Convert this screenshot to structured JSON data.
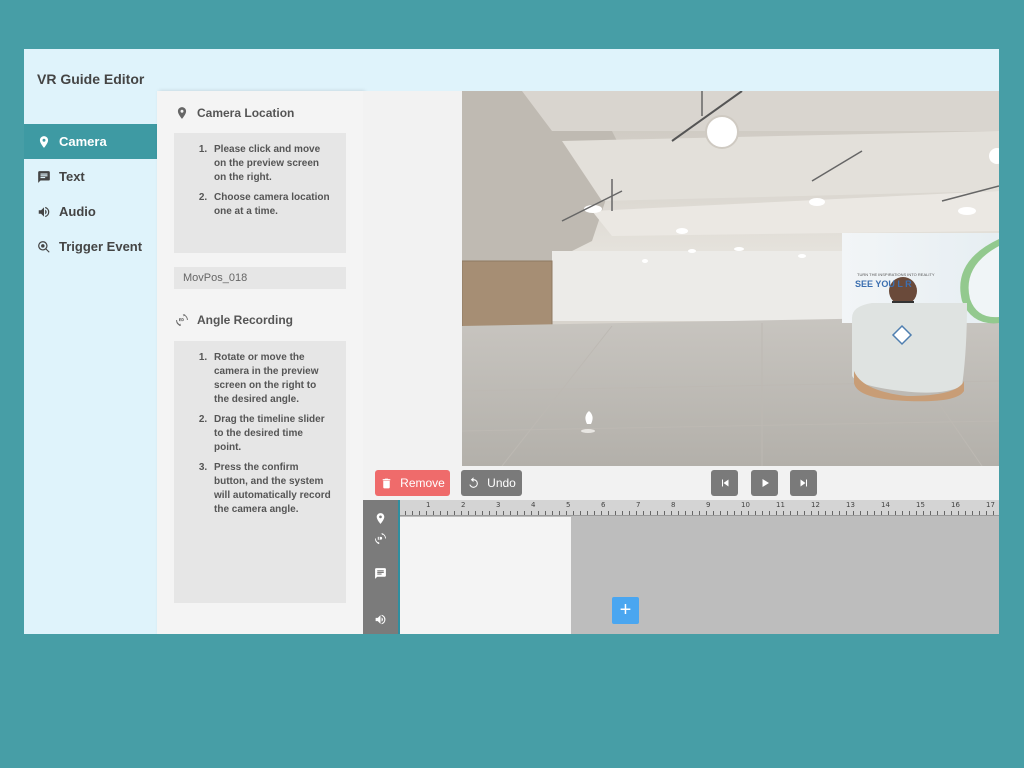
{
  "app": {
    "title": "VR Guide Editor"
  },
  "nav": {
    "items": [
      {
        "label": "Camera",
        "icon": "location-pin-icon",
        "active": true
      },
      {
        "label": "Text",
        "icon": "comment-icon",
        "active": false
      },
      {
        "label": "Audio",
        "icon": "volume-icon",
        "active": false
      },
      {
        "label": "Trigger Event",
        "icon": "search-gear-icon",
        "active": false
      }
    ]
  },
  "panel": {
    "camera_location": {
      "title": "Camera Location",
      "steps": [
        "Please click and move on the preview screen on the right.",
        "Choose camera location one at a time."
      ],
      "position_value": "MovPos_018"
    },
    "angle_recording": {
      "title": "Angle Recording",
      "steps": [
        "Rotate or move the camera in the preview screen on the right to the desired angle.",
        "Drag the timeline slider to the desired time point.",
        "Press the confirm button, and the system will automatically record the camera angle."
      ]
    }
  },
  "preview": {
    "screen_small_text": "TURN THE INSPIRATIONS INTO REALITY",
    "screen_big_text": "SEE YOU L  R"
  },
  "controls": {
    "remove_label": "Remove",
    "undo_label": "Undo"
  },
  "timeline": {
    "ruler_labels": [
      "1",
      "2",
      "3",
      "4",
      "5",
      "6",
      "7",
      "8",
      "9",
      "10",
      "11",
      "12",
      "13",
      "14",
      "15",
      "16",
      "17"
    ],
    "add_label": "+"
  },
  "colors": {
    "page_bg": "#479ea6",
    "window_bg": "#dff3fb",
    "nav_active": "#3e9aa3",
    "remove": "#ef6b6b",
    "add": "#4aa6f0"
  }
}
